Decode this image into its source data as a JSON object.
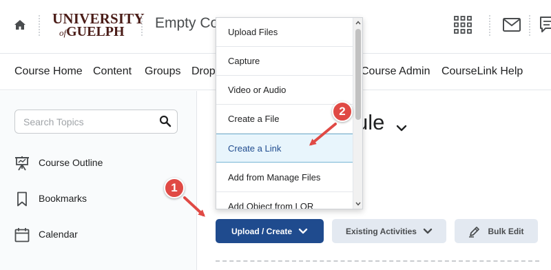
{
  "header": {
    "logo_line1": "UNIVERSITY",
    "logo_of": "of",
    "logo_line2": "GUELPH",
    "course_title": "Empty Co"
  },
  "nav": {
    "items": [
      "Course Home",
      "Content",
      "Groups",
      "Drop",
      "Course Admin",
      "CourseLink Help"
    ]
  },
  "sidebar": {
    "search_placeholder": "Search Topics",
    "items": [
      {
        "label": "Course Outline",
        "icon": "presentation-board-icon"
      },
      {
        "label": "Bookmarks",
        "icon": "bookmark-icon"
      },
      {
        "label": "Calendar",
        "icon": "calendar-icon"
      }
    ]
  },
  "main": {
    "module_title_fragment": "ule",
    "buttons": {
      "upload_create": "Upload / Create",
      "existing_activities": "Existing Activities",
      "bulk_edit": "Bulk Edit"
    }
  },
  "menu": {
    "items": [
      "Upload Files",
      "Capture",
      "Video or Audio",
      "Create a File",
      "Create a Link",
      "Add from Manage Files",
      "Add Object from LOR"
    ],
    "selected": "Create a Link"
  },
  "annotations": {
    "step1": "1",
    "step2": "2"
  },
  "colors": {
    "primary": "#1f4b8e",
    "secondary_button": "#e3e9f1",
    "annotation": "#e04a45",
    "menu_selected_bg": "#e8f5fc"
  }
}
